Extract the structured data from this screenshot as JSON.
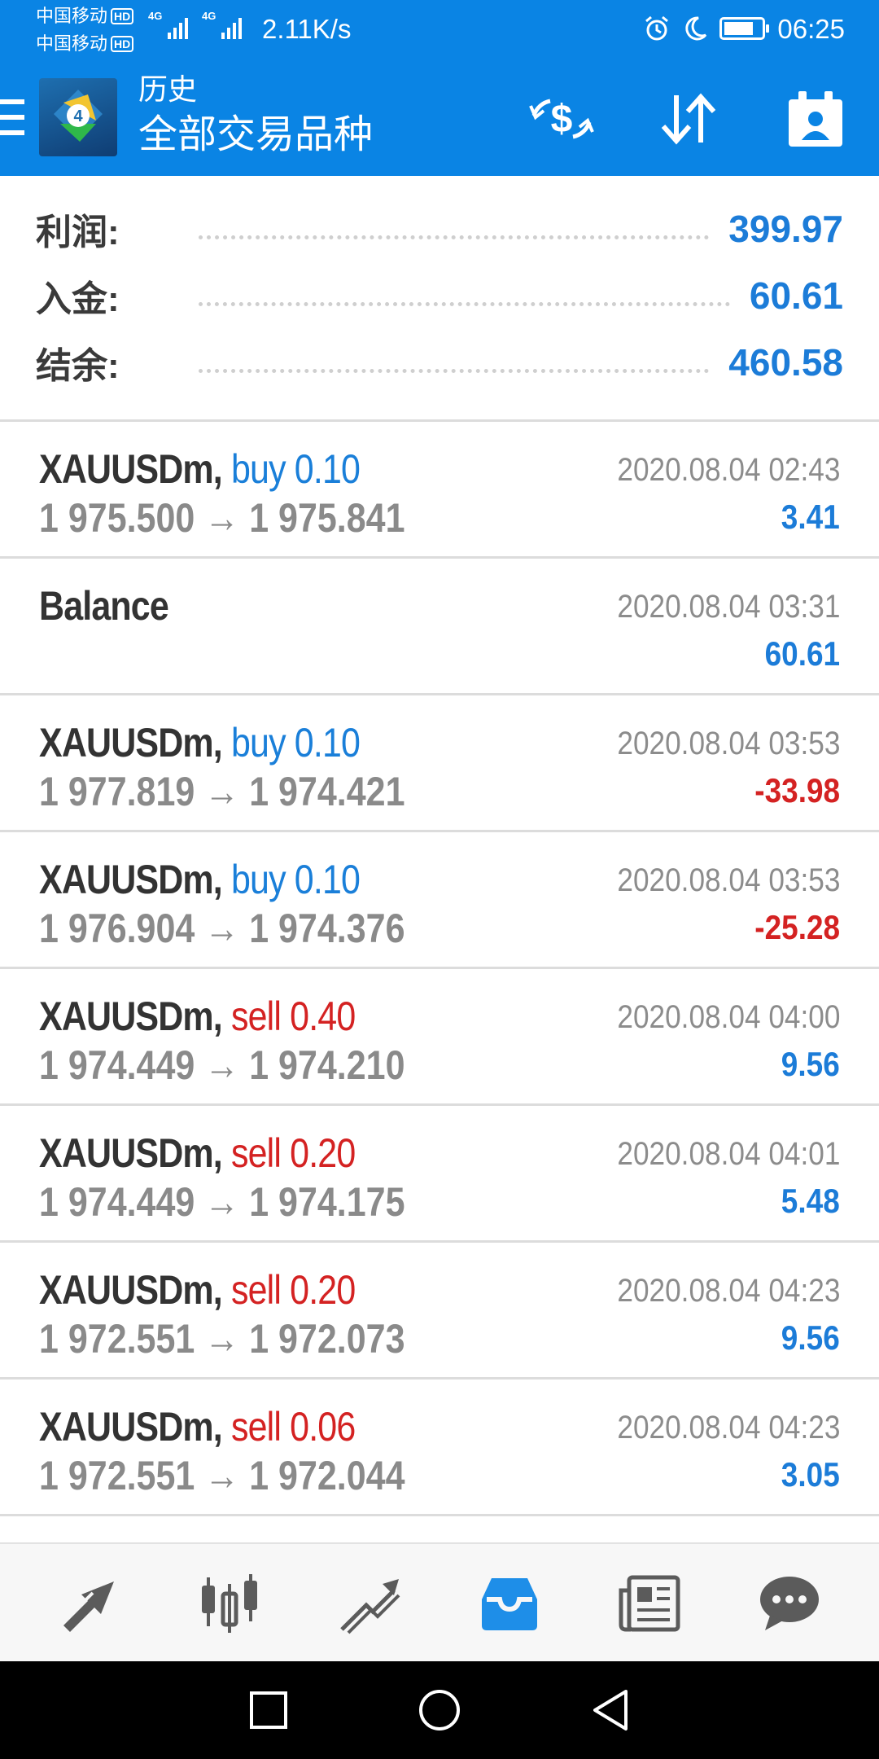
{
  "status_bar": {
    "carrier_1": "中国移动",
    "carrier_2": "中国移动",
    "hd_badge": "HD",
    "network_label": "4G",
    "net_speed": "2.11K/s",
    "time": "06:25",
    "battery_level": 0.8
  },
  "app_bar": {
    "subtitle": "历史",
    "title": "全部交易品种",
    "icons": [
      "menu-icon",
      "mt4-logo",
      "currency-exchange-icon",
      "sort-icon",
      "calendar-person-icon"
    ]
  },
  "summary": {
    "profit_label": "利润:",
    "profit_value": "399.97",
    "deposit_label": "入金:",
    "deposit_value": "60.61",
    "balance_label": "结余:",
    "balance_value": "460.58"
  },
  "deals": [
    {
      "symbol": "XAUUSDm,",
      "side": "buy 0.10",
      "side_type": "buy",
      "prices": "1 975.500 → 1 975.841",
      "time": "2020.08.04 02:43",
      "profit": "3.41",
      "profit_type": "pos"
    },
    {
      "symbol": "Balance",
      "side": "",
      "side_type": "",
      "prices": "",
      "time": "2020.08.04 03:31",
      "profit": "60.61",
      "profit_type": "pos"
    },
    {
      "symbol": "XAUUSDm,",
      "side": "buy 0.10",
      "side_type": "buy",
      "prices": "1 977.819 → 1 974.421",
      "time": "2020.08.04 03:53",
      "profit": "-33.98",
      "profit_type": "neg"
    },
    {
      "symbol": "XAUUSDm,",
      "side": "buy 0.10",
      "side_type": "buy",
      "prices": "1 976.904 → 1 974.376",
      "time": "2020.08.04 03:53",
      "profit": "-25.28",
      "profit_type": "neg"
    },
    {
      "symbol": "XAUUSDm,",
      "side": "sell 0.40",
      "side_type": "sell",
      "prices": "1 974.449 → 1 974.210",
      "time": "2020.08.04 04:00",
      "profit": "9.56",
      "profit_type": "pos"
    },
    {
      "symbol": "XAUUSDm,",
      "side": "sell 0.20",
      "side_type": "sell",
      "prices": "1 974.449 → 1 974.175",
      "time": "2020.08.04 04:01",
      "profit": "5.48",
      "profit_type": "pos"
    },
    {
      "symbol": "XAUUSDm,",
      "side": "sell 0.20",
      "side_type": "sell",
      "prices": "1 972.551 → 1 972.073",
      "time": "2020.08.04 04:23",
      "profit": "9.56",
      "profit_type": "pos"
    },
    {
      "symbol": "XAUUSDm,",
      "side": "sell 0.06",
      "side_type": "sell",
      "prices": "1 972.551 → 1 972.044",
      "time": "2020.08.04 04:23",
      "profit": "3.05",
      "profit_type": "pos"
    }
  ],
  "bottom_nav": {
    "items": [
      "quotes-icon",
      "chart-icon",
      "trade-icon",
      "history-icon",
      "news-icon",
      "chat-icon"
    ],
    "active": "history-icon"
  },
  "system_nav": [
    "recent-apps-icon",
    "home-icon",
    "back-icon"
  ],
  "colors": {
    "header_blue": "#0a84e4",
    "positive_blue": "#1c7cd8",
    "negative_red": "#d42222",
    "active_nav": "#1e8ee8"
  }
}
